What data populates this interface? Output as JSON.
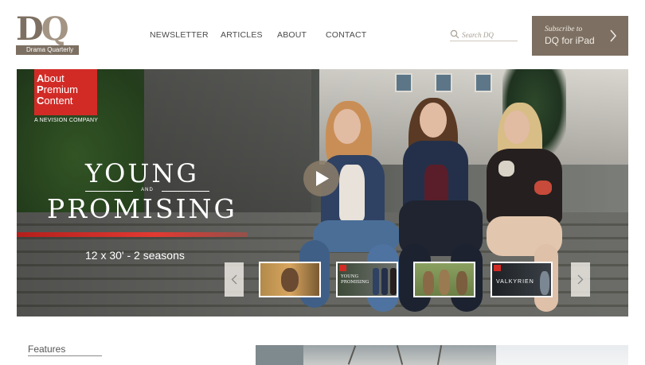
{
  "logo": {
    "letters_d": "D",
    "letters_q": "Q",
    "name": "Drama Quarterly"
  },
  "nav": {
    "items": [
      {
        "label": "NEWSLETTER"
      },
      {
        "label": "ARTICLES"
      },
      {
        "label": "ABOUT"
      },
      {
        "label": "CONTACT"
      }
    ]
  },
  "search": {
    "placeholder": "Search DQ",
    "icon": "search-icon"
  },
  "subscribe": {
    "line1": "Subscribe to",
    "line2": "DQ for iPad",
    "icon": "chevron-right-icon"
  },
  "hero": {
    "apc": {
      "line1_first": "A",
      "line1_rest": "bout",
      "line2_first": "P",
      "line2_rest": "remium",
      "line3_first": "C",
      "line3_rest": "ontent",
      "tagline": "A NEVISION COMPANY"
    },
    "title_young": "YOUNG",
    "title_and": "AND",
    "title_promising": "PROMISING",
    "episodes": "12 x 30' - 2 seasons",
    "play_icon": "play-icon",
    "carousel": {
      "prev_icon": "chevron-left-icon",
      "next_icon": "chevron-right-icon",
      "thumbs": [
        {
          "text": ""
        },
        {
          "text": "YOUNG PROMISING"
        },
        {
          "text": ""
        },
        {
          "text": "VALKYRIEN"
        }
      ]
    }
  },
  "features": {
    "title": "Features"
  },
  "colors": {
    "brand_taupe": "#7d7062",
    "apc_red": "#d22b26",
    "nav_text": "#4a4a4a"
  }
}
